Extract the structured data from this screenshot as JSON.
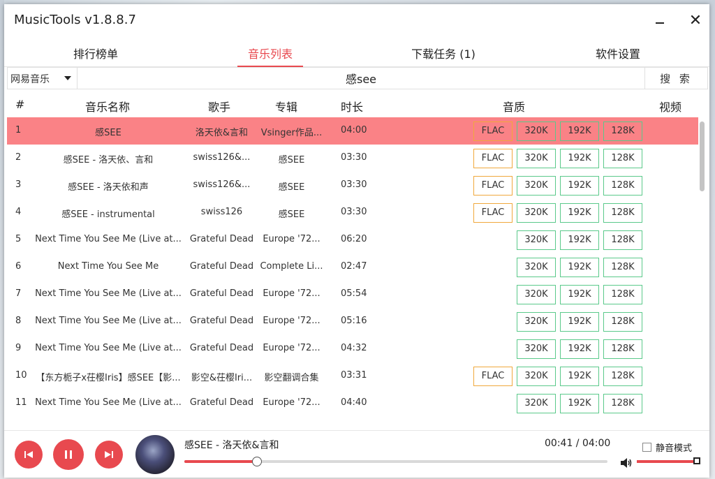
{
  "window": {
    "title": "MusicTools v1.8.8.7",
    "minimize": "—",
    "close": "✕"
  },
  "nav": {
    "tabs": [
      {
        "label": "排行榜单"
      },
      {
        "label": "音乐列表"
      },
      {
        "label": "下载任务 (1)"
      },
      {
        "label": "软件设置"
      }
    ],
    "active_index": 1
  },
  "search": {
    "source": "网易音乐",
    "query": "感see",
    "button_label": "搜 索"
  },
  "table": {
    "headers": {
      "index": "#",
      "name": "音乐名称",
      "artist": "歌手",
      "album": "专辑",
      "duration": "时长",
      "quality": "音质",
      "video": "视频"
    },
    "rows": [
      {
        "idx": "1",
        "name": "感SEE",
        "artist": "洛天依&言和",
        "album": "Vsinger作品...",
        "duration": "04:00",
        "flac": "FLAC",
        "q320": "320K",
        "q192": "192K",
        "q128": "128K",
        "active": true
      },
      {
        "idx": "2",
        "name": "感SEE - 洛天依、言和",
        "artist": "swiss126&...",
        "album": "感SEE",
        "duration": "03:30",
        "flac": "FLAC",
        "q320": "320K",
        "q192": "192K",
        "q128": "128K"
      },
      {
        "idx": "3",
        "name": "感SEE - 洛天依和声",
        "artist": "swiss126&...",
        "album": "感SEE",
        "duration": "03:30",
        "flac": "FLAC",
        "q320": "320K",
        "q192": "192K",
        "q128": "128K"
      },
      {
        "idx": "4",
        "name": "感SEE - instrumental",
        "artist": "swiss126",
        "album": "感SEE",
        "duration": "03:30",
        "flac": "FLAC",
        "q320": "320K",
        "q192": "192K",
        "q128": "128K"
      },
      {
        "idx": "5",
        "name": "Next Time You See Me (Live at...",
        "artist": "Grateful Dead",
        "album": "Europe '72...",
        "duration": "06:20",
        "flac": "",
        "q320": "320K",
        "q192": "192K",
        "q128": "128K"
      },
      {
        "idx": "6",
        "name": "Next Time You See Me",
        "artist": "Grateful Dead",
        "album": "Complete Li...",
        "duration": "02:47",
        "flac": "",
        "q320": "320K",
        "q192": "192K",
        "q128": "128K"
      },
      {
        "idx": "7",
        "name": "Next Time You See Me (Live at...",
        "artist": "Grateful Dead",
        "album": "Europe '72...",
        "duration": "05:54",
        "flac": "",
        "q320": "320K",
        "q192": "192K",
        "q128": "128K"
      },
      {
        "idx": "8",
        "name": "Next Time You See Me (Live at...",
        "artist": "Grateful Dead",
        "album": "Europe '72...",
        "duration": "05:16",
        "flac": "",
        "q320": "320K",
        "q192": "192K",
        "q128": "128K"
      },
      {
        "idx": "9",
        "name": "Next Time You See Me (Live at...",
        "artist": "Grateful Dead",
        "album": "Europe '72...",
        "duration": "04:32",
        "flac": "",
        "q320": "320K",
        "q192": "192K",
        "q128": "128K"
      },
      {
        "idx": "10",
        "name": "【东方栀子x茌樱Iris】感SEE【影...",
        "artist": "影空&茌樱Iri...",
        "album": "影空翻调合集",
        "duration": "03:31",
        "flac": "FLAC",
        "q320": "320K",
        "q192": "192K",
        "q128": "128K"
      },
      {
        "idx": "11",
        "name": "Next Time You See Me (Live at...",
        "artist": "Grateful Dead",
        "album": "Europe '72...",
        "duration": "04:40",
        "flac": "",
        "q320": "320K",
        "q192": "192K",
        "q128": "128K"
      }
    ]
  },
  "player": {
    "song": "感SEE - 洛天依&言和",
    "time": "00:41 / 04:00",
    "progress": 0.171,
    "mute_label": "静音模式",
    "mute_checked": false,
    "volume": 1.0
  },
  "colors": {
    "accent": "#e8494f",
    "active_row": "#fa8286",
    "flac_border": "#f0a83c",
    "quality_border": "#5ac98a"
  },
  "icons": {
    "prev": "skip-previous-icon",
    "pause": "pause-icon",
    "next": "skip-next-icon",
    "volume": "volume-icon"
  }
}
